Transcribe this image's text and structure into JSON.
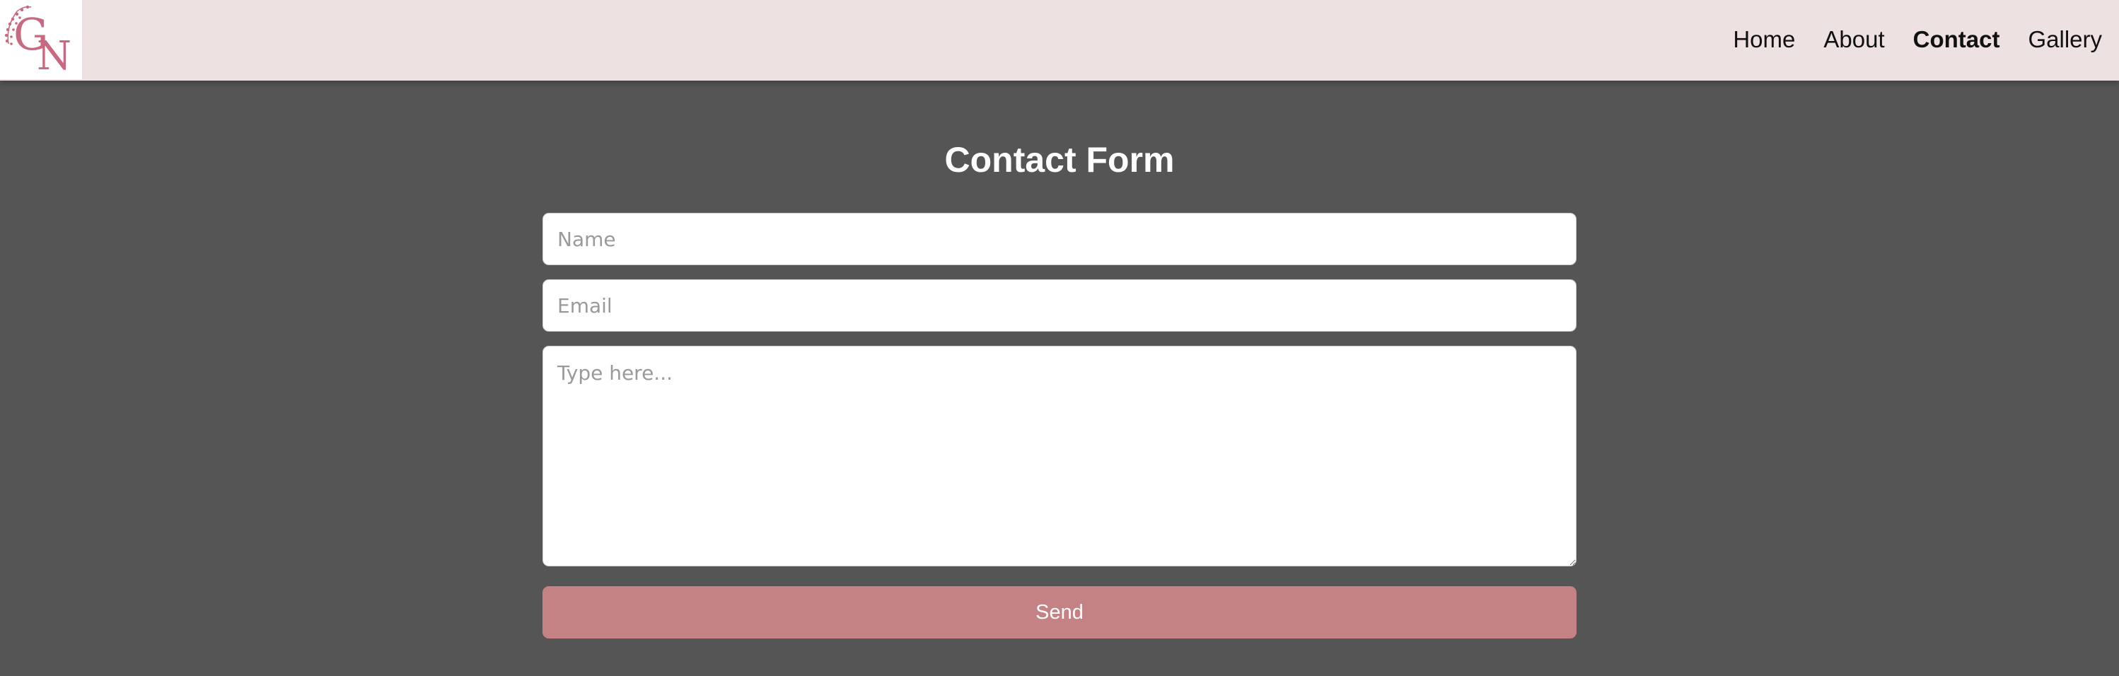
{
  "brand": {
    "logo_text": "GN",
    "logo_color": "#c9697f"
  },
  "nav": {
    "items": [
      {
        "label": "Home",
        "active": false
      },
      {
        "label": "About",
        "active": false
      },
      {
        "label": "Contact",
        "active": true
      },
      {
        "label": "Gallery",
        "active": false
      }
    ]
  },
  "form": {
    "title": "Contact Form",
    "name_placeholder": "Name",
    "name_value": "",
    "email_placeholder": "Email",
    "email_value": "",
    "message_placeholder": "Type here...",
    "message_value": "",
    "send_label": "Send"
  },
  "colors": {
    "header_bg": "#ede1e1",
    "page_bg": "#555555",
    "button_bg": "#c48284",
    "accent": "#c9697f"
  }
}
